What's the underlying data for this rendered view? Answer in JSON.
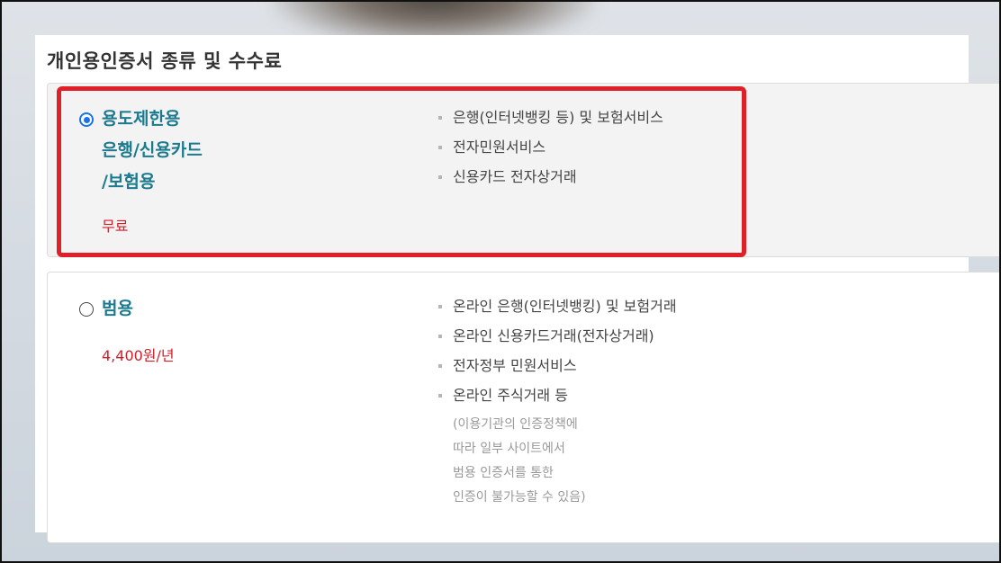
{
  "page_title": "개인용인증서 종류 및 수수료",
  "options": [
    {
      "name_lines": [
        "용도제한용",
        "은행/신용카드",
        "/보험용"
      ],
      "price": "무료",
      "selected": true,
      "features": [
        "은행(인터넷뱅킹 등) 및 보험서비스",
        "전자민원서비스",
        "신용카드 전자상거래"
      ]
    },
    {
      "name_lines": [
        "범용"
      ],
      "price": "4,400원/년",
      "selected": false,
      "features": [
        "온라인 은행(인터넷뱅킹) 및 보험거래",
        "온라인 신용카드거래(전자상거래)",
        "전자정부 민원서비스",
        "온라인 주식거래 등"
      ],
      "note_lines": [
        "(이용기관의 인증정책에",
        "따라 일부 사이트에서",
        "범용 인증서를 통한",
        "인증이 불가능할 수 있음)"
      ]
    }
  ],
  "colors": {
    "accent": "#1b7a8f",
    "price": "#d0202a",
    "highlight_border": "#e11f26",
    "radio_checked": "#1a73e8"
  },
  "icons": {
    "radio_selected": "radio-checked-icon",
    "radio_unselected": "radio-unchecked-icon",
    "bullet": "square-bullet-icon"
  }
}
